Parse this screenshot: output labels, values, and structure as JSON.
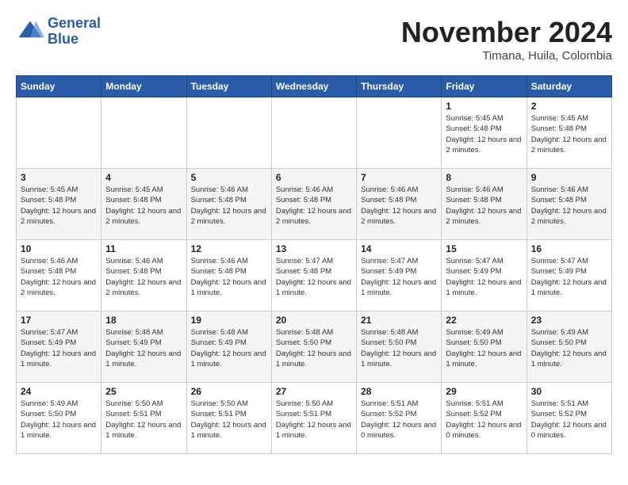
{
  "logo": {
    "line1": "General",
    "line2": "Blue"
  },
  "header": {
    "month": "November 2024",
    "location": "Timana, Huila, Colombia"
  },
  "weekdays": [
    "Sunday",
    "Monday",
    "Tuesday",
    "Wednesday",
    "Thursday",
    "Friday",
    "Saturday"
  ],
  "weeks": [
    [
      {
        "day": "",
        "info": ""
      },
      {
        "day": "",
        "info": ""
      },
      {
        "day": "",
        "info": ""
      },
      {
        "day": "",
        "info": ""
      },
      {
        "day": "",
        "info": ""
      },
      {
        "day": "1",
        "info": "Sunrise: 5:45 AM\nSunset: 5:48 PM\nDaylight: 12 hours\nand 2 minutes."
      },
      {
        "day": "2",
        "info": "Sunrise: 5:45 AM\nSunset: 5:48 PM\nDaylight: 12 hours\nand 2 minutes."
      }
    ],
    [
      {
        "day": "3",
        "info": "Sunrise: 5:45 AM\nSunset: 5:48 PM\nDaylight: 12 hours\nand 2 minutes."
      },
      {
        "day": "4",
        "info": "Sunrise: 5:45 AM\nSunset: 5:48 PM\nDaylight: 12 hours\nand 2 minutes."
      },
      {
        "day": "5",
        "info": "Sunrise: 5:46 AM\nSunset: 5:48 PM\nDaylight: 12 hours\nand 2 minutes."
      },
      {
        "day": "6",
        "info": "Sunrise: 5:46 AM\nSunset: 5:48 PM\nDaylight: 12 hours\nand 2 minutes."
      },
      {
        "day": "7",
        "info": "Sunrise: 5:46 AM\nSunset: 5:48 PM\nDaylight: 12 hours\nand 2 minutes."
      },
      {
        "day": "8",
        "info": "Sunrise: 5:46 AM\nSunset: 5:48 PM\nDaylight: 12 hours\nand 2 minutes."
      },
      {
        "day": "9",
        "info": "Sunrise: 5:46 AM\nSunset: 5:48 PM\nDaylight: 12 hours\nand 2 minutes."
      }
    ],
    [
      {
        "day": "10",
        "info": "Sunrise: 5:46 AM\nSunset: 5:48 PM\nDaylight: 12 hours\nand 2 minutes."
      },
      {
        "day": "11",
        "info": "Sunrise: 5:46 AM\nSunset: 5:48 PM\nDaylight: 12 hours\nand 2 minutes."
      },
      {
        "day": "12",
        "info": "Sunrise: 5:46 AM\nSunset: 5:48 PM\nDaylight: 12 hours\nand 1 minute."
      },
      {
        "day": "13",
        "info": "Sunrise: 5:47 AM\nSunset: 5:48 PM\nDaylight: 12 hours\nand 1 minute."
      },
      {
        "day": "14",
        "info": "Sunrise: 5:47 AM\nSunset: 5:49 PM\nDaylight: 12 hours\nand 1 minute."
      },
      {
        "day": "15",
        "info": "Sunrise: 5:47 AM\nSunset: 5:49 PM\nDaylight: 12 hours\nand 1 minute."
      },
      {
        "day": "16",
        "info": "Sunrise: 5:47 AM\nSunset: 5:49 PM\nDaylight: 12 hours\nand 1 minute."
      }
    ],
    [
      {
        "day": "17",
        "info": "Sunrise: 5:47 AM\nSunset: 5:49 PM\nDaylight: 12 hours\nand 1 minute."
      },
      {
        "day": "18",
        "info": "Sunrise: 5:48 AM\nSunset: 5:49 PM\nDaylight: 12 hours\nand 1 minute."
      },
      {
        "day": "19",
        "info": "Sunrise: 5:48 AM\nSunset: 5:49 PM\nDaylight: 12 hours\nand 1 minute."
      },
      {
        "day": "20",
        "info": "Sunrise: 5:48 AM\nSunset: 5:50 PM\nDaylight: 12 hours\nand 1 minute."
      },
      {
        "day": "21",
        "info": "Sunrise: 5:48 AM\nSunset: 5:50 PM\nDaylight: 12 hours\nand 1 minute."
      },
      {
        "day": "22",
        "info": "Sunrise: 5:49 AM\nSunset: 5:50 PM\nDaylight: 12 hours\nand 1 minute."
      },
      {
        "day": "23",
        "info": "Sunrise: 5:49 AM\nSunset: 5:50 PM\nDaylight: 12 hours\nand 1 minute."
      }
    ],
    [
      {
        "day": "24",
        "info": "Sunrise: 5:49 AM\nSunset: 5:50 PM\nDaylight: 12 hours\nand 1 minute."
      },
      {
        "day": "25",
        "info": "Sunrise: 5:50 AM\nSunset: 5:51 PM\nDaylight: 12 hours\nand 1 minute."
      },
      {
        "day": "26",
        "info": "Sunrise: 5:50 AM\nSunset: 5:51 PM\nDaylight: 12 hours\nand 1 minute."
      },
      {
        "day": "27",
        "info": "Sunrise: 5:50 AM\nSunset: 5:51 PM\nDaylight: 12 hours\nand 1 minute."
      },
      {
        "day": "28",
        "info": "Sunrise: 5:51 AM\nSunset: 5:52 PM\nDaylight: 12 hours\nand 0 minutes."
      },
      {
        "day": "29",
        "info": "Sunrise: 5:51 AM\nSunset: 5:52 PM\nDaylight: 12 hours\nand 0 minutes."
      },
      {
        "day": "30",
        "info": "Sunrise: 5:51 AM\nSunset: 5:52 PM\nDaylight: 12 hours\nand 0 minutes."
      }
    ]
  ]
}
